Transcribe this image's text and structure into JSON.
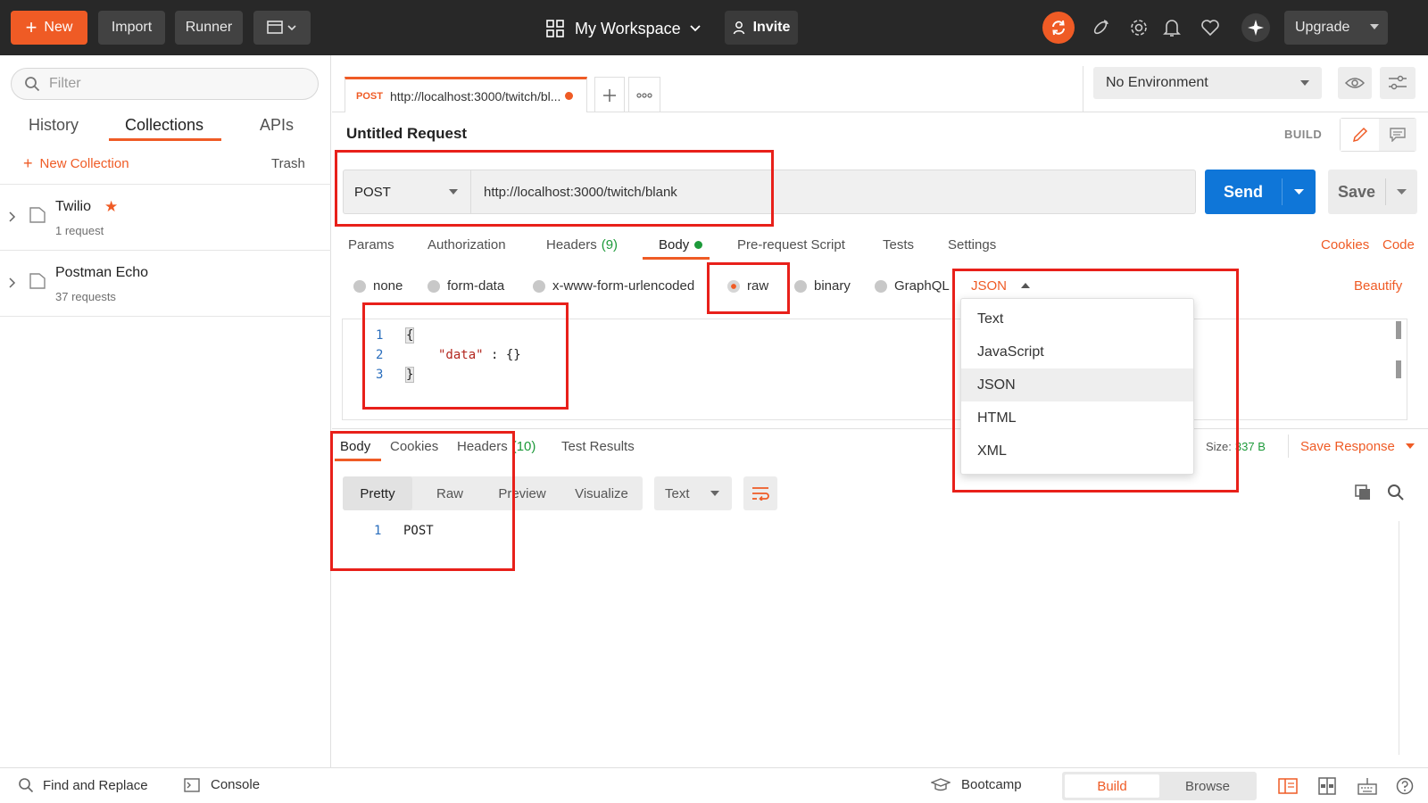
{
  "topbar": {
    "new_label": "New",
    "import_label": "Import",
    "runner_label": "Runner",
    "workspace_label": "My Workspace",
    "invite_label": "Invite",
    "upgrade_label": "Upgrade",
    "accent_color": "#ef5b25"
  },
  "sidebar": {
    "filter_placeholder": "Filter",
    "tabs": [
      "History",
      "Collections",
      "APIs"
    ],
    "active_tab": "Collections",
    "new_collection_label": "New Collection",
    "trash_label": "Trash",
    "collections": [
      {
        "name": "Twilio",
        "count": "1 request",
        "starred": true
      },
      {
        "name": "Postman Echo",
        "count": "37 requests",
        "starred": false
      }
    ]
  },
  "tabs": {
    "request_tab_method": "POST",
    "request_tab_url": "http://localhost:3000/twitch/bl..."
  },
  "environment": {
    "selected": "No Environment"
  },
  "request": {
    "title": "Untitled Request",
    "mode_label": "BUILD",
    "method": "POST",
    "url": "http://localhost:3000/twitch/blank",
    "send_label": "Send",
    "save_label": "Save",
    "subtabs": [
      "Params",
      "Authorization",
      "Headers",
      "Body",
      "Pre-request Script",
      "Tests",
      "Settings"
    ],
    "headers_count": "(9)",
    "cookies_label": "Cookies",
    "code_label": "Code",
    "body_types": [
      "none",
      "form-data",
      "x-www-form-urlencoded",
      "raw",
      "binary",
      "GraphQL"
    ],
    "selected_body_type": "raw",
    "format_selected": "JSON",
    "beautify_label": "Beautify",
    "editor_lines": [
      {
        "num": "1",
        "text": "{"
      },
      {
        "num": "2",
        "key": "\"data\"",
        "rest": " : {}"
      },
      {
        "num": "3",
        "text": "}"
      }
    ]
  },
  "format_dropdown": {
    "options": [
      "Text",
      "JavaScript",
      "JSON",
      "HTML",
      "XML"
    ],
    "highlighted": "JSON"
  },
  "response": {
    "tabs": [
      "Body",
      "Cookies",
      "Headers",
      "Test Results"
    ],
    "headers_count": "(10)",
    "size_label": "Size:",
    "size_value": "337 B",
    "save_response_label": "Save Response",
    "view_modes": [
      "Pretty",
      "Raw",
      "Preview",
      "Visualize"
    ],
    "format": "Text",
    "line_num": "1",
    "line_text": "POST"
  },
  "bottombar": {
    "find_replace_label": "Find and Replace",
    "console_label": "Console",
    "bootcamp_label": "Bootcamp",
    "build_label": "Build",
    "browse_label": "Browse"
  }
}
